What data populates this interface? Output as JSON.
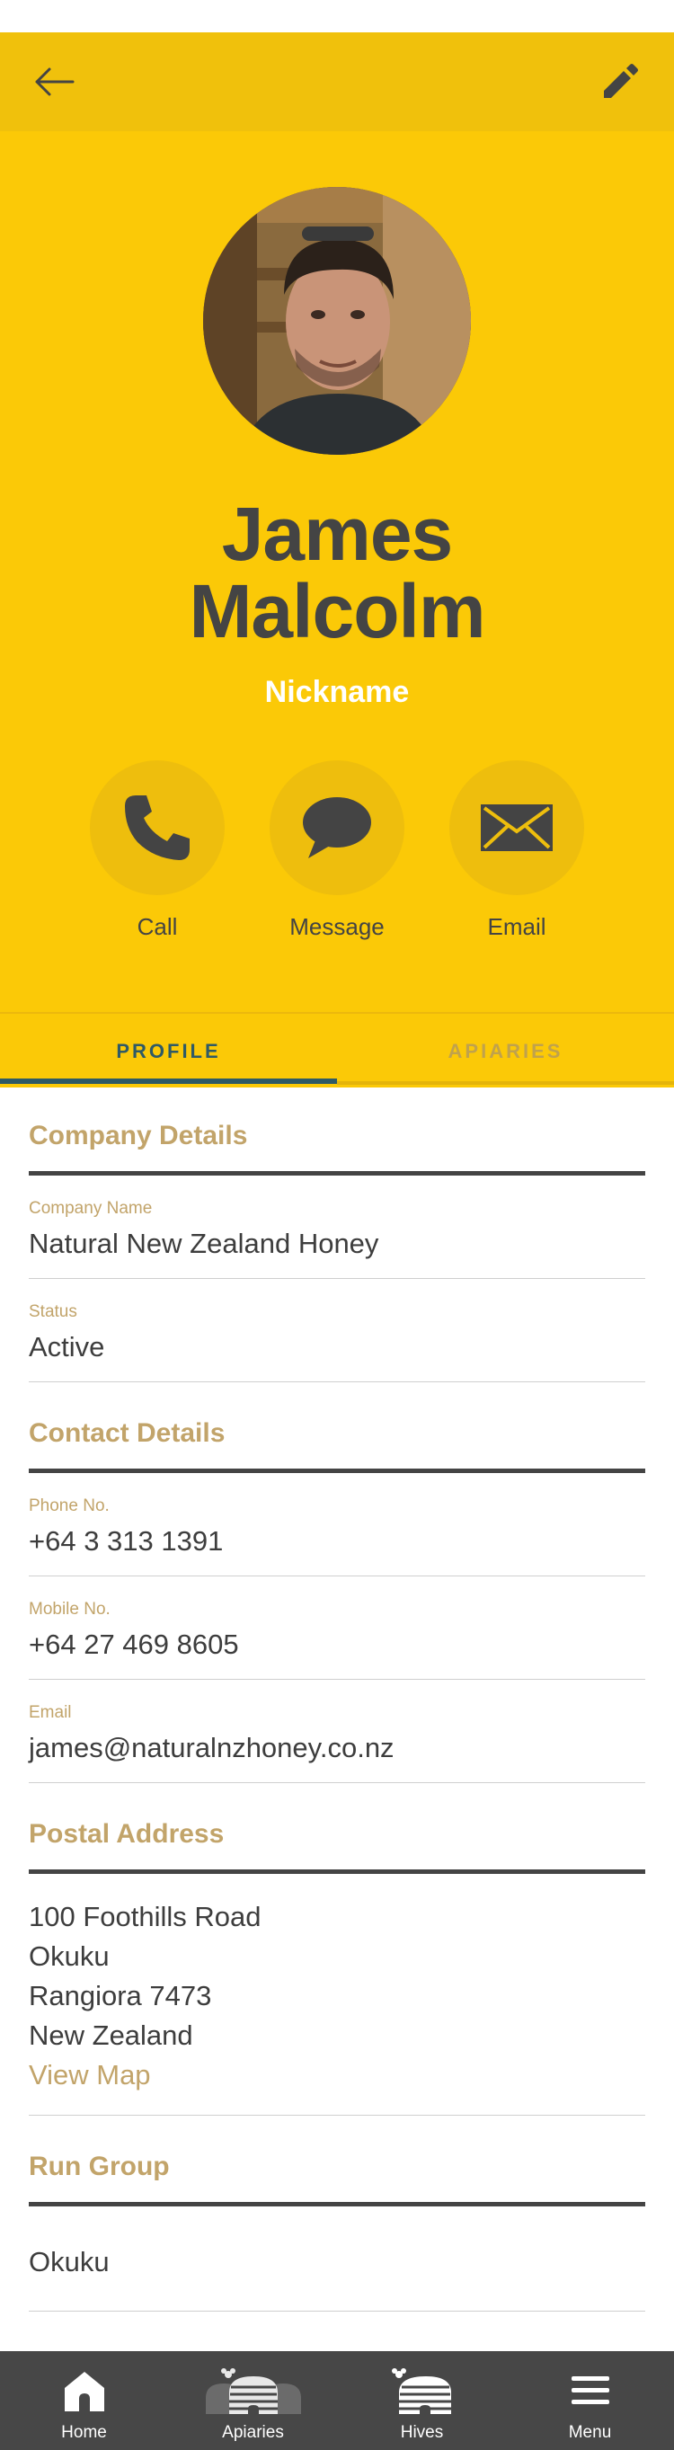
{
  "header": {
    "back_icon": "arrow-left-icon",
    "edit_icon": "pencil-icon"
  },
  "profile": {
    "name_line1": "James",
    "name_line2": "Malcolm",
    "nickname": "Nickname",
    "avatar_alt": "profile-photo"
  },
  "actions": [
    {
      "label": "Call",
      "icon": "phone-icon"
    },
    {
      "label": "Message",
      "icon": "chat-bubble-icon"
    },
    {
      "label": "Email",
      "icon": "envelope-icon"
    }
  ],
  "tabs": [
    {
      "label": "PROFILE",
      "active": true
    },
    {
      "label": "APIARIES",
      "active": false
    }
  ],
  "sections": {
    "company": {
      "title": "Company Details",
      "company_name_label": "Company Name",
      "company_name": "Natural New Zealand Honey",
      "status_label": "Status",
      "status": "Active"
    },
    "contact": {
      "title": "Contact Details",
      "phone_label": "Phone No.",
      "phone": "+64 3 313 1391",
      "mobile_label": "Mobile No.",
      "mobile": "+64 27 469 8605",
      "email_label": "Email",
      "email": "james@naturalnzhoney.co.nz"
    },
    "postal": {
      "title": "Postal Address",
      "lines": [
        "100 Foothills Road",
        "Okuku",
        "Rangiora 7473",
        "New Zealand"
      ],
      "view_map": "View Map"
    },
    "run_group": {
      "title": "Run Group",
      "value": "Okuku"
    }
  },
  "bottom_nav": [
    {
      "label": "Home",
      "icon": "home-icon"
    },
    {
      "label": "Apiaries",
      "icon": "apiaries-icon"
    },
    {
      "label": "Hives",
      "icon": "hive-icon"
    },
    {
      "label": "Menu",
      "icon": "hamburger-menu-icon"
    }
  ],
  "colors": {
    "yellow": "#fbc907",
    "dark_yellow": "#f0c10c",
    "text_dark": "#444444",
    "accent_gold": "#c2a46a",
    "tab_active": "#2f5a66",
    "nav_bg": "#474747"
  }
}
